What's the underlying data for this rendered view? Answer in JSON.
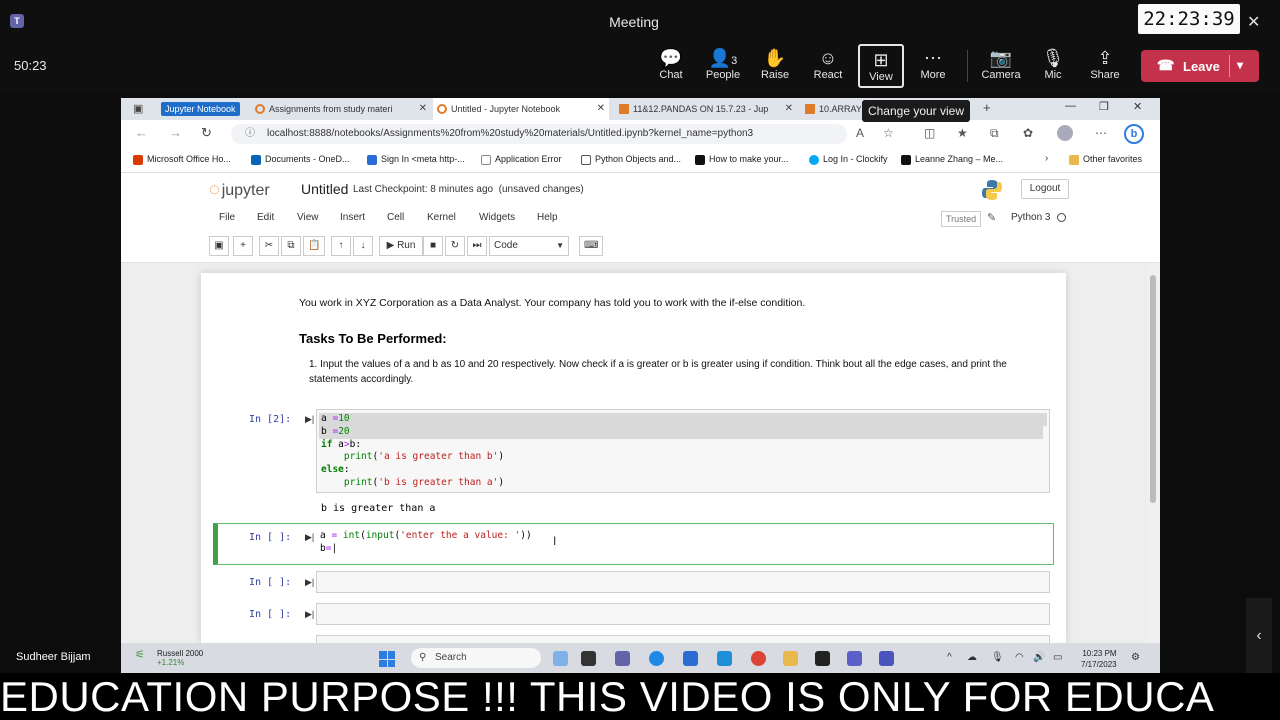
{
  "teams": {
    "window_title": "Meeting",
    "clock": "22:23:39",
    "elapsed": "50:23",
    "controls": [
      {
        "label": "Chat",
        "icon": "chat-icon"
      },
      {
        "label": "People",
        "icon": "people-icon",
        "count": "3"
      },
      {
        "label": "Raise",
        "icon": "hand-icon"
      },
      {
        "label": "React",
        "icon": "smile-icon"
      },
      {
        "label": "View",
        "icon": "grid-icon"
      },
      {
        "label": "More",
        "icon": "more-icon"
      },
      {
        "label": "Camera",
        "icon": "camera-off-icon"
      },
      {
        "label": "Mic",
        "icon": "mic-icon"
      },
      {
        "label": "Share",
        "icon": "share-icon"
      }
    ],
    "leave_label": "Leave",
    "tooltip": "Change your view",
    "presenter": "Sudheer Bijjam"
  },
  "browser": {
    "tabs": [
      {
        "label": "Jupyter Notebook",
        "color": "#1e6dc9"
      },
      {
        "label": "Assignments from study materi",
        "color": "#e07b2a"
      },
      {
        "label": "Untitled - Jupyter Notebook",
        "color": "#e07b2a"
      },
      {
        "label": "11&12.PANDAS ON 15.7.23 - Jup",
        "color": "#e07b2a"
      },
      {
        "label": "10.ARRAYS",
        "color": "#e07b2a"
      }
    ],
    "url": "localhost:8888/notebooks/Assignments%20from%20study%20materials/Untitled.ipynb?kernel_name=python3",
    "bookmarks": [
      {
        "label": "Microsoft Office Ho...",
        "color": "#d83b01"
      },
      {
        "label": "Documents - OneD...",
        "color": "#0364b8"
      },
      {
        "label": "Sign In <meta http-...",
        "color": "#2b6cd4"
      },
      {
        "label": "Application Error",
        "color": "#888888"
      },
      {
        "label": "Python Objects and...",
        "color": "#333333"
      },
      {
        "label": "How to make your...",
        "color": "#111111"
      },
      {
        "label": "Log In - Clockify",
        "color": "#03a9f4"
      },
      {
        "label": "Leanne Zhang – Me...",
        "color": "#111111"
      }
    ],
    "other_favorites": "Other favorites"
  },
  "jupyter": {
    "brand": "jupyter",
    "notebook_name": "Untitled",
    "checkpoint": "Last Checkpoint: 8 minutes ago",
    "unsaved": "(unsaved changes)",
    "logout": "Logout",
    "menus": [
      "File",
      "Edit",
      "View",
      "Insert",
      "Cell",
      "Kernel",
      "Widgets",
      "Help"
    ],
    "trusted": "Trusted",
    "kernel_name": "Python 3",
    "run_label": "Run",
    "cell_type": "Code",
    "markdown": {
      "intro": "You work in XYZ Corporation as a Data Analyst. Your company has told you to work with the if-else condition.",
      "heading": "Tasks To Be Performed:",
      "task_number": "1.",
      "task": "Input the values of a and b as 10 and 20 respectively. Now check if a is greater or b is greater using if condition. Think bout all the edge cases, and print the statements accordingly."
    },
    "cells": [
      {
        "prompt": "In [2]:",
        "output": "b is greater than a"
      },
      {
        "prompt": "In [ ]:"
      },
      {
        "prompt": "In [ ]:"
      },
      {
        "prompt": "In [ ]:"
      }
    ]
  },
  "taskbar": {
    "stock_name": "Russell 2000",
    "stock_change": "+1.21%",
    "search_placeholder": "Search",
    "time": "10:23 PM",
    "date": "7/17/2023"
  },
  "caption": "EDUCATION PURPOSE !!! THIS VIDEO IS ONLY FOR EDUCA"
}
